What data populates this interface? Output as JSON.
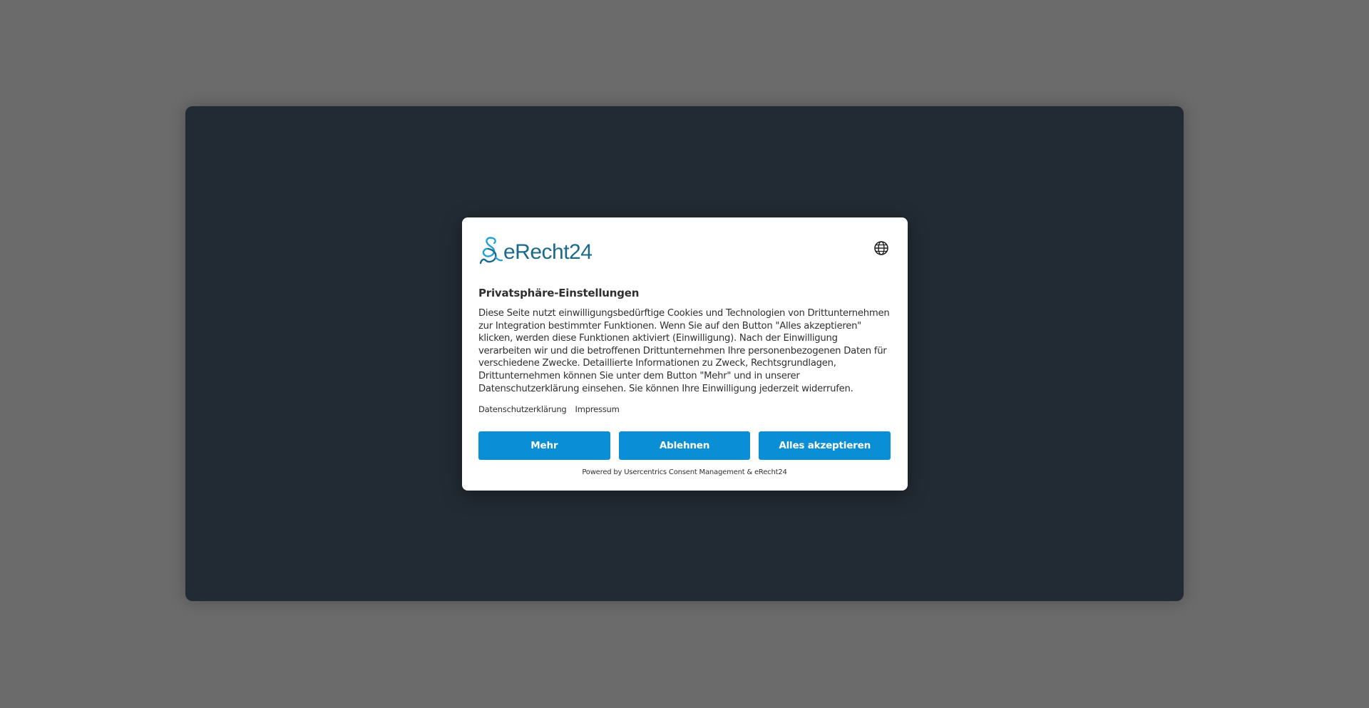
{
  "background": {
    "page_color": "#6b6b6b",
    "window_color": "#222a33"
  },
  "dialog": {
    "logo": {
      "text": "eRecht24",
      "icon": "erecht24-logo-icon",
      "color": "#1a6a8c"
    },
    "language_button_icon": "globe-icon",
    "title": "Privatsphäre-Einstellungen",
    "description": "Diese Seite nutzt einwilligungsbedürftige Cookies und Technologien von Drittunternehmen zur Integration bestimmter Funktionen. Wenn Sie auf den Button \"Alles akzeptieren\" klicken, werden diese Funktionen aktiviert (Einwilligung). Nach der Einwilligung verarbeiten wir und die betroffenen Drittunternehmen Ihre personenbezogenen Daten für verschiedene Zwecke. Detaillierte Informationen zu Zweck, Rechtsgrundlagen, Drittunternehmen können Sie unter dem Button \"Mehr\" und in unserer Datenschutzerklärung einsehen. Sie können Ihre Einwilligung jederzeit widerrufen.",
    "links": {
      "privacy": "Datenschutzerklärung",
      "imprint": "Impressum"
    },
    "buttons": {
      "more": "Mehr",
      "deny": "Ablehnen",
      "accept_all": "Alles akzeptieren",
      "color": "#0a8fd6"
    },
    "powered_by": "Powered by Usercentrics Consent Management & eRecht24"
  }
}
